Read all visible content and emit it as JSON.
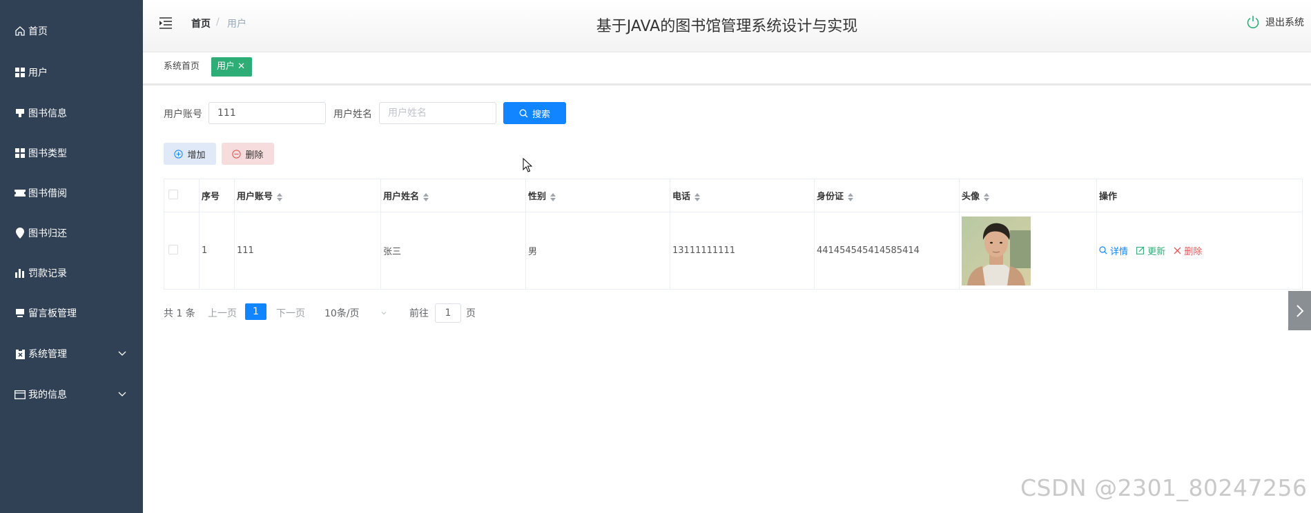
{
  "sidebar": {
    "items": [
      {
        "label": "首页",
        "icon": "home-icon"
      },
      {
        "label": "用户",
        "icon": "grid-icon"
      },
      {
        "label": "图书信息",
        "icon": "pin-icon"
      },
      {
        "label": "图书类型",
        "icon": "grid-icon"
      },
      {
        "label": "图书借阅",
        "icon": "ticket-icon"
      },
      {
        "label": "图书归还",
        "icon": "location-icon"
      },
      {
        "label": "罚款记录",
        "icon": "bar-chart-icon"
      },
      {
        "label": "留言板管理",
        "icon": "monitor-icon"
      },
      {
        "label": "系统管理",
        "icon": "clipboard-icon"
      },
      {
        "label": "我的信息",
        "icon": "card-icon"
      }
    ]
  },
  "header": {
    "breadcrumb_home": "首页",
    "breadcrumb_sep": "/",
    "breadcrumb_current": "用户",
    "title": "基于JAVA的图书馆管理系统设计与实现",
    "logout": "退出系统"
  },
  "tags": {
    "home": "系统首页",
    "active": "用户",
    "close": "✕"
  },
  "search": {
    "account_label": "用户账号",
    "account_value": "111",
    "name_label": "用户姓名",
    "name_placeholder": "用户姓名",
    "button": "搜索"
  },
  "actions": {
    "add": "增加",
    "delete": "删除"
  },
  "table": {
    "headers": {
      "index": "序号",
      "account": "用户账号",
      "name": "用户姓名",
      "gender": "性别",
      "phone": "电话",
      "idcard": "身份证",
      "avatar": "头像",
      "ops": "操作"
    },
    "rows": [
      {
        "index": "1",
        "account": "111",
        "name": "张三",
        "gender": "男",
        "phone": "13111111111",
        "idcard": "441454545414585414",
        "op_detail": "详情",
        "op_update": "更新",
        "op_delete": "删除"
      }
    ]
  },
  "pagination": {
    "total": "共 1 条",
    "prev": "上一页",
    "current": "1",
    "next": "下一页",
    "page_size": "10条/页",
    "goto": "前往",
    "goto_value": "1",
    "page_unit": "页"
  },
  "watermark": "CSDN @2301_80247256",
  "colors": {
    "sidebar_bg": "#304156",
    "primary": "#1185ff",
    "tag_active": "#2fad77",
    "link_blue": "#1185ff",
    "link_green": "#2fad77",
    "link_red": "#e05656"
  }
}
